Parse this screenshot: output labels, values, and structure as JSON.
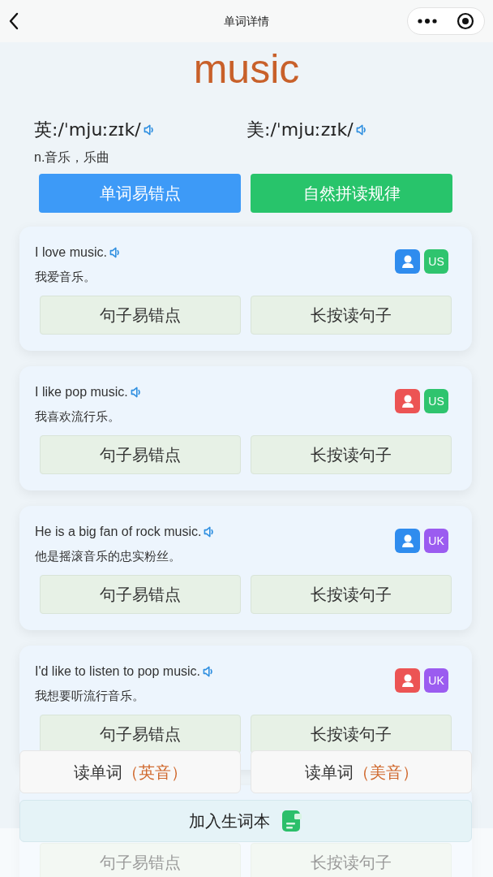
{
  "nav": {
    "title": "单词详情"
  },
  "word": {
    "text": "music",
    "definition": "n.音乐，乐曲"
  },
  "phonetics": [
    {
      "label": "英:/ˈmjuːzɪk/"
    },
    {
      "label": "美:/ˈmjuːzɪk/"
    }
  ],
  "word_buttons": [
    {
      "label": "单词易错点",
      "kind": "primary"
    },
    {
      "label": "自然拼读规律",
      "kind": "success"
    }
  ],
  "cards": [
    {
      "sentence": "I love music.",
      "translation": "我爱音乐。",
      "speaker": {
        "kind": "male"
      },
      "accent": {
        "label": "US",
        "color": "#2fc46e"
      },
      "buttons": [
        "句子易错点",
        "长按读句子"
      ]
    },
    {
      "sentence": "I like pop music.",
      "translation": "我喜欢流行乐。",
      "speaker": {
        "kind": "female"
      },
      "accent": {
        "label": "US",
        "color": "#2fc46e"
      },
      "buttons": [
        "句子易错点",
        "长按读句子"
      ]
    },
    {
      "sentence": "He is a big fan of rock music.",
      "translation": "他是摇滚音乐的忠实粉丝。",
      "speaker": {
        "kind": "male"
      },
      "accent": {
        "label": "UK",
        "color": "#9b5cf0"
      },
      "buttons": [
        "句子易错点",
        "长按读句子"
      ]
    },
    {
      "sentence": "I'd like to listen to pop music.",
      "translation": "我想要听流行音乐。",
      "speaker": {
        "kind": "female"
      },
      "accent": {
        "label": "UK",
        "color": "#9b5cf0"
      },
      "buttons": [
        "句子易错点",
        "长按读句子"
      ]
    },
    {
      "buttons": [
        "句子易错点",
        "长按读句子"
      ]
    }
  ],
  "read_buttons": [
    {
      "label": "读单词",
      "accent": "（英音）"
    },
    {
      "label": "读单词",
      "accent": "（美音）"
    }
  ],
  "add_button": {
    "label": "加入生词本"
  }
}
